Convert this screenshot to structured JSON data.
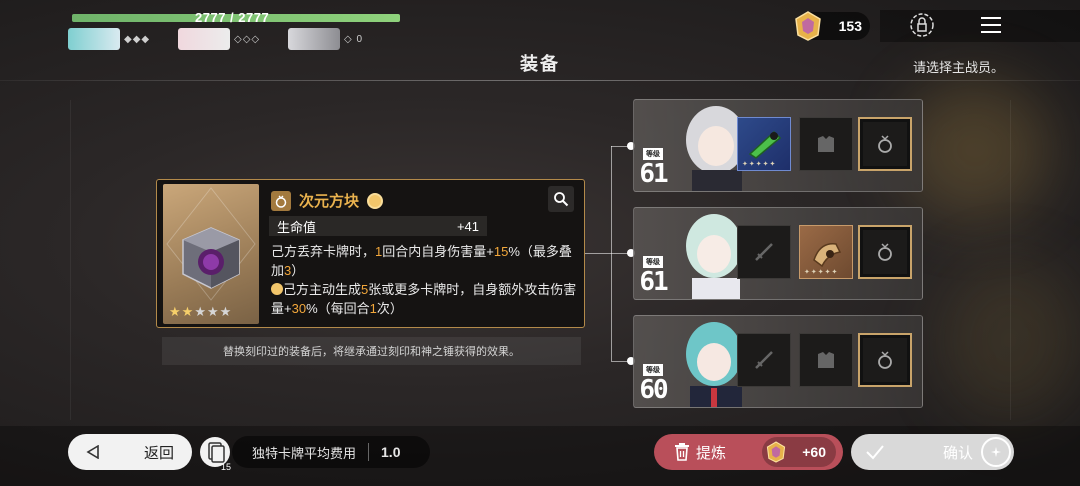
{
  "hud": {
    "hp_text": "2777 / 2777",
    "hp_ratio": 1.0,
    "party": [
      {
        "pips": "◆◆◆"
      },
      {
        "pips": "◇◇◇"
      },
      {
        "pips": "◇ 0"
      }
    ]
  },
  "header": {
    "title": "装备",
    "hint": "请选择主战员。"
  },
  "currency": {
    "amount": "153"
  },
  "item": {
    "name": "次元方块",
    "stat_label": "生命值",
    "stat_value": "+41",
    "desc1_a": "己方丢弃卡牌时，",
    "desc1_b": "1",
    "desc1_c": "回合内自身伤害量+",
    "desc1_d": "15",
    "desc1_e": "%（最多叠加",
    "desc1_f": "3",
    "desc1_g": "）",
    "desc2_a": "己方主动生成",
    "desc2_b": "5",
    "desc2_c": "张或更多卡牌时，自身额外攻击伤害量+",
    "desc2_d": "30",
    "desc2_e": "%（每回合",
    "desc2_f": "1",
    "desc2_g": "次）",
    "stars_filled": "★★",
    "stars_empty": "★★★",
    "note": "替换刻印过的装备后，将继承通过刻印和神之锤获得的效果。"
  },
  "characters": [
    {
      "level_label": "等级",
      "level": "61",
      "hair": "#d8d8dc",
      "slots": [
        "weapon-filled",
        "armor-empty",
        "accessory-empty"
      ]
    },
    {
      "level_label": "等级",
      "level": "61",
      "hair": "#cfe8e0",
      "slots": [
        "weapon-empty",
        "armor-filled",
        "accessory-empty"
      ]
    },
    {
      "level_label": "等级",
      "level": "60",
      "hair": "#6ec6c8",
      "slots": [
        "weapon-empty",
        "armor-empty",
        "accessory-empty"
      ]
    }
  ],
  "bottom": {
    "back_label": "返回",
    "deck_count": "15",
    "avg_cost_label": "独特卡牌平均费用",
    "avg_cost_value": "1.0",
    "refine_label": "提炼",
    "refine_cost": "+60",
    "confirm_label": "确认"
  },
  "colors": {
    "accent_gold": "#e9b24e",
    "refine": "#b94f5a",
    "hp_green": "#8fd27c"
  }
}
